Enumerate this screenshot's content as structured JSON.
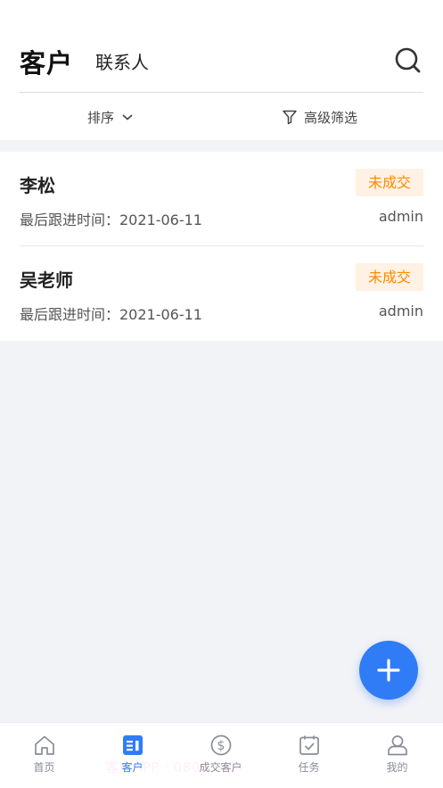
{
  "header": {
    "tab_active": "客户",
    "tab_other": "联系人",
    "sort_label": "排序",
    "filter_label": "高级筛选"
  },
  "customers": [
    {
      "name": "李松",
      "status": "未成交",
      "followup": "最后跟进时间：2021-06-11",
      "owner": "admin"
    },
    {
      "name": "吴老师",
      "status": "未成交",
      "followup": "最后跟进时间：2021-06-11",
      "owner": "admin"
    }
  ],
  "tabbar": [
    {
      "label": "首页",
      "icon": "home-icon",
      "active": false
    },
    {
      "label": "客户",
      "icon": "customer-icon",
      "active": true
    },
    {
      "label": "成交客户",
      "icon": "dollar-icon",
      "active": false
    },
    {
      "label": "任务",
      "icon": "task-icon",
      "active": false
    },
    {
      "label": "我的",
      "icon": "user-icon",
      "active": false
    }
  ],
  "watermark": "客户APP · 0800 0M",
  "colors": {
    "accent": "#2f7cf6",
    "badge_text": "#ff8a00",
    "badge_bg": "#fff1e3",
    "page_bg": "#f2f3f7"
  }
}
